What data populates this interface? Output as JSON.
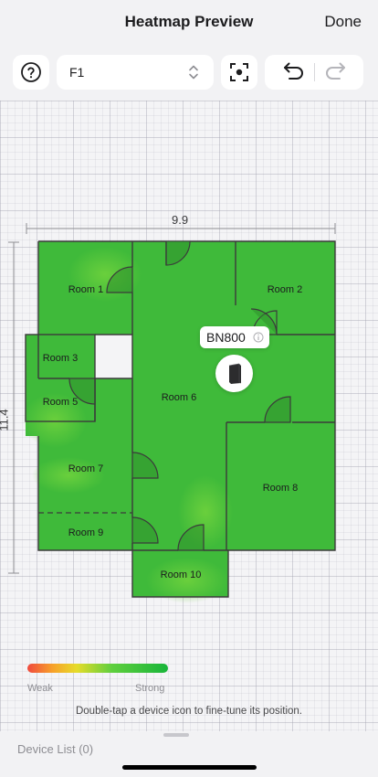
{
  "nav": {
    "title": "Heatmap Preview",
    "done_label": "Done"
  },
  "toolbar": {
    "help_icon": "question-circle-icon",
    "floor_value": "F1",
    "floor_icon": "chevron-up-down-icon",
    "fit_icon": "focus-frame-icon",
    "undo_icon": "undo-arrow-icon",
    "redo_icon": "redo-arrow-icon"
  },
  "floorplan": {
    "width_label": "9.9",
    "height_label": "11.4",
    "rooms": [
      {
        "name": "Room 1"
      },
      {
        "name": "Room 2"
      },
      {
        "name": "Room 3"
      },
      {
        "name": "Room 5"
      },
      {
        "name": "Room 6"
      },
      {
        "name": "Room 7"
      },
      {
        "name": "Room 8"
      },
      {
        "name": "Room 9"
      },
      {
        "name": "Room 10"
      }
    ],
    "device": {
      "name": "BN800",
      "icon": "router-device-icon",
      "info_icon": "info-circle-icon"
    }
  },
  "legend": {
    "weak_label": "Weak",
    "strong_label": "Strong",
    "colors": [
      "#f0493e",
      "#f7a12a",
      "#e6dc2a",
      "#5fcf3d",
      "#18b53a"
    ]
  },
  "hint": "Double-tap a device icon to fine-tune its position.",
  "device_list_label": "Device List (0)",
  "colors": {
    "signal_green": "#3fba3a",
    "wall": "#3b3b3b",
    "background": "#f2f2f4"
  }
}
